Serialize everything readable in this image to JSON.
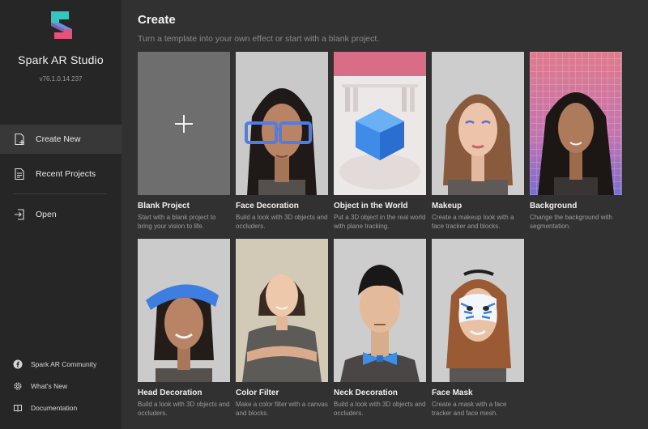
{
  "sidebar": {
    "app_name": "Spark AR Studio",
    "version": "v76.1.0.14.237",
    "nav": [
      {
        "label": "Create New",
        "icon": "create-new-icon",
        "active": true
      },
      {
        "label": "Recent Projects",
        "icon": "document-icon",
        "active": false
      },
      {
        "label": "Open",
        "icon": "open-icon",
        "active": false
      }
    ],
    "footer": [
      {
        "label": "Spark AR Community",
        "icon": "facebook-icon"
      },
      {
        "label": "What's New",
        "icon": "gear-icon"
      },
      {
        "label": "Documentation",
        "icon": "book-icon"
      }
    ]
  },
  "main": {
    "title": "Create",
    "subtitle": "Turn a template into your own effect or start with a blank project.",
    "templates": [
      {
        "title": "Blank Project",
        "desc": "Start with a blank project to bring your vision to life."
      },
      {
        "title": "Face Decoration",
        "desc": "Build a look with 3D objects and occluders."
      },
      {
        "title": "Object in the World",
        "desc": "Put a 3D object in the real world with plane tracking."
      },
      {
        "title": "Makeup",
        "desc": "Create a makeup look with a face tracker and blocks."
      },
      {
        "title": "Background",
        "desc": "Change the background with segmentation."
      },
      {
        "title": "Head Decoration",
        "desc": "Build a look with 3D objects and occluders."
      },
      {
        "title": "Color Filter",
        "desc": "Make a color filter with a canvas and blocks."
      },
      {
        "title": "Neck Decoration",
        "desc": "Build a look with 3D objects and occluders."
      },
      {
        "title": "Face Mask",
        "desc": "Create a mask with a face tracker and face mesh."
      }
    ]
  },
  "colors": {
    "sidebar_bg": "#262626",
    "main_bg": "#313131",
    "logo_teal": "#2ec4b6",
    "logo_pink": "#e84a7f"
  }
}
